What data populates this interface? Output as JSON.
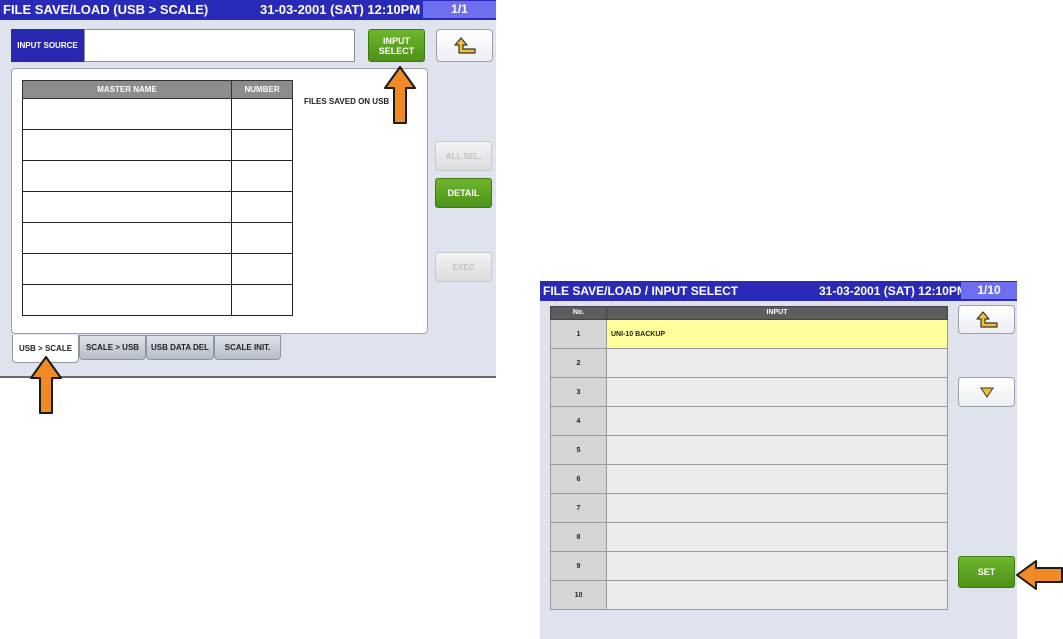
{
  "screen1": {
    "title": "FILE SAVE/LOAD (USB > SCALE)",
    "datetime": "31-03-2001 (SAT)  12:10PM",
    "page": "1/1",
    "input_source_label": "INPUT SOURCE",
    "input_source_value": "",
    "input_select_label": "INPUT SELECT",
    "table_headers": [
      "MASTER NAME",
      "NUMBER"
    ],
    "files_saved_label": "FILES SAVED ON USB",
    "all_sel_label": "ALL SEL.",
    "detail_label": "DETAIL",
    "exec_label": "EXEC",
    "tabs": [
      "USB > SCALE",
      "SCALE > USB",
      "USB DATA DEL",
      "SCALE INIT."
    ],
    "active_tab": "USB > SCALE"
  },
  "screen2": {
    "title": "FILE SAVE/LOAD / INPUT SELECT",
    "datetime": "31-03-2001 (SAT)  12:10PM",
    "page": "1/10",
    "table_headers": [
      "No.",
      "INPUT"
    ],
    "rows": [
      {
        "no": "1",
        "input": "UNI-10 BACKUP"
      },
      {
        "no": "2",
        "input": ""
      },
      {
        "no": "3",
        "input": ""
      },
      {
        "no": "4",
        "input": ""
      },
      {
        "no": "5",
        "input": ""
      },
      {
        "no": "6",
        "input": ""
      },
      {
        "no": "7",
        "input": ""
      },
      {
        "no": "8",
        "input": ""
      },
      {
        "no": "9",
        "input": ""
      },
      {
        "no": "10",
        "input": ""
      }
    ],
    "selected_row": "1",
    "set_label": "SET"
  },
  "icons": {
    "back": "return-arrow-icon",
    "scroll_down": "triangle-down-icon",
    "callout": "orange-arrow-icon"
  },
  "colors": {
    "titlebar": "#2a2ab8",
    "page_indicator": "#6e6ef0",
    "green_button": "#5aa320",
    "highlight": "#ffff9c",
    "callout_arrow": "#f08a24"
  }
}
